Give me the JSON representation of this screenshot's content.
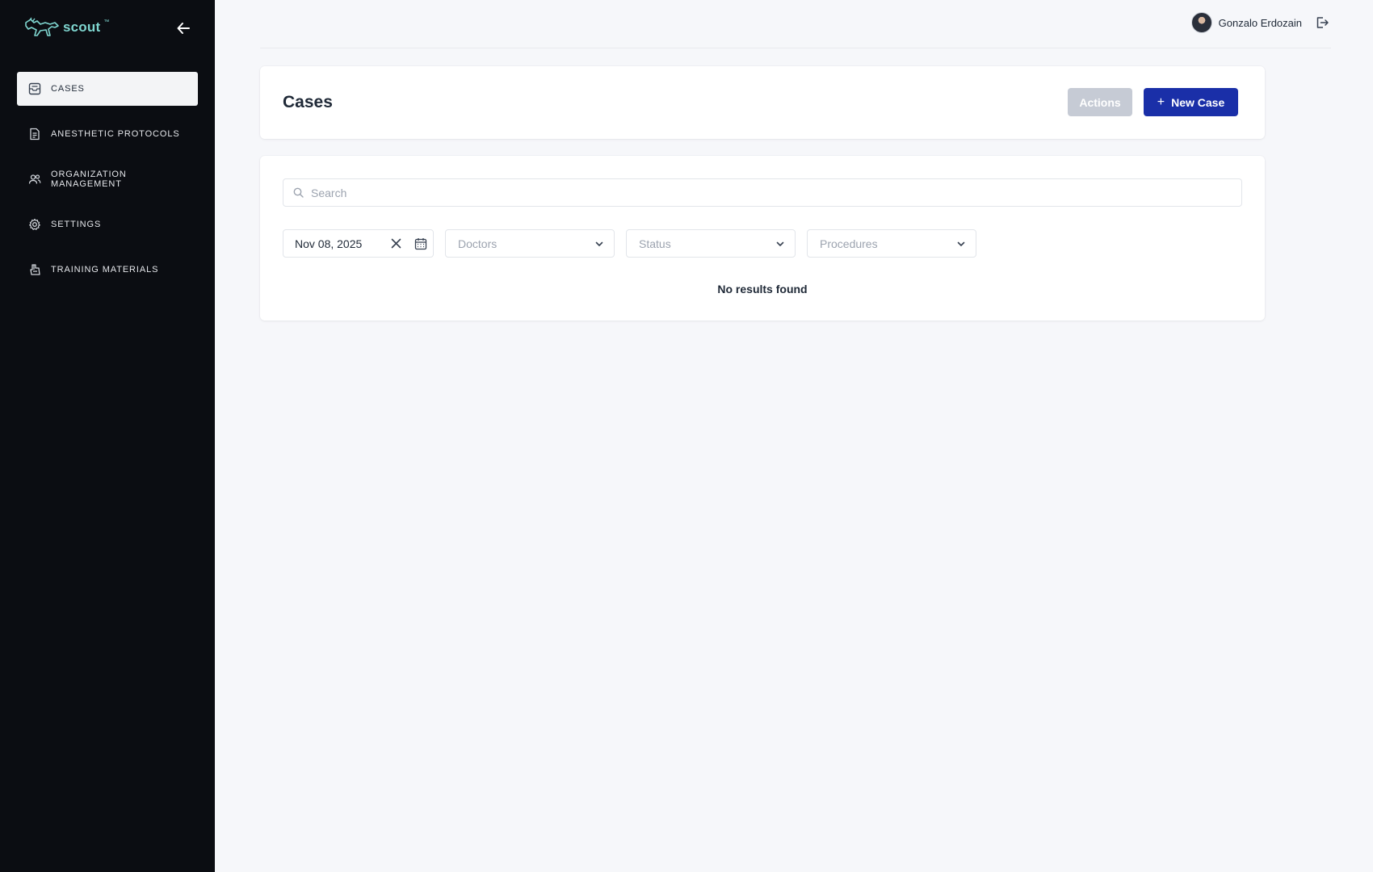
{
  "app": {
    "logo_text": "scout",
    "logo_tm": "™"
  },
  "sidebar": {
    "items": [
      {
        "label": "CASES",
        "icon": "inbox-icon",
        "active": true
      },
      {
        "label": "ANESTHETIC PROTOCOLS",
        "icon": "document-icon",
        "active": false
      },
      {
        "label": "ORGANIZATION MANAGEMENT",
        "icon": "users-icon",
        "active": false
      },
      {
        "label": "SETTINGS",
        "icon": "gear-icon",
        "active": false
      },
      {
        "label": "TRAINING MATERIALS",
        "icon": "training-icon",
        "active": false
      }
    ]
  },
  "user": {
    "name": "Gonzalo Erdozain"
  },
  "header": {
    "title": "Cases",
    "actions_label": "Actions",
    "new_case_label": "New Case"
  },
  "filters": {
    "search_placeholder": "Search",
    "date_value": "Nov 08, 2025",
    "doctors_placeholder": "Doctors",
    "status_placeholder": "Status",
    "procedures_placeholder": "Procedures"
  },
  "results": {
    "empty_message": "No results found"
  },
  "colors": {
    "sidebar_bg": "#0b0d12",
    "primary": "#1a2fa8",
    "disabled": "#c6cbd5",
    "logo": "#7fd6d0"
  }
}
